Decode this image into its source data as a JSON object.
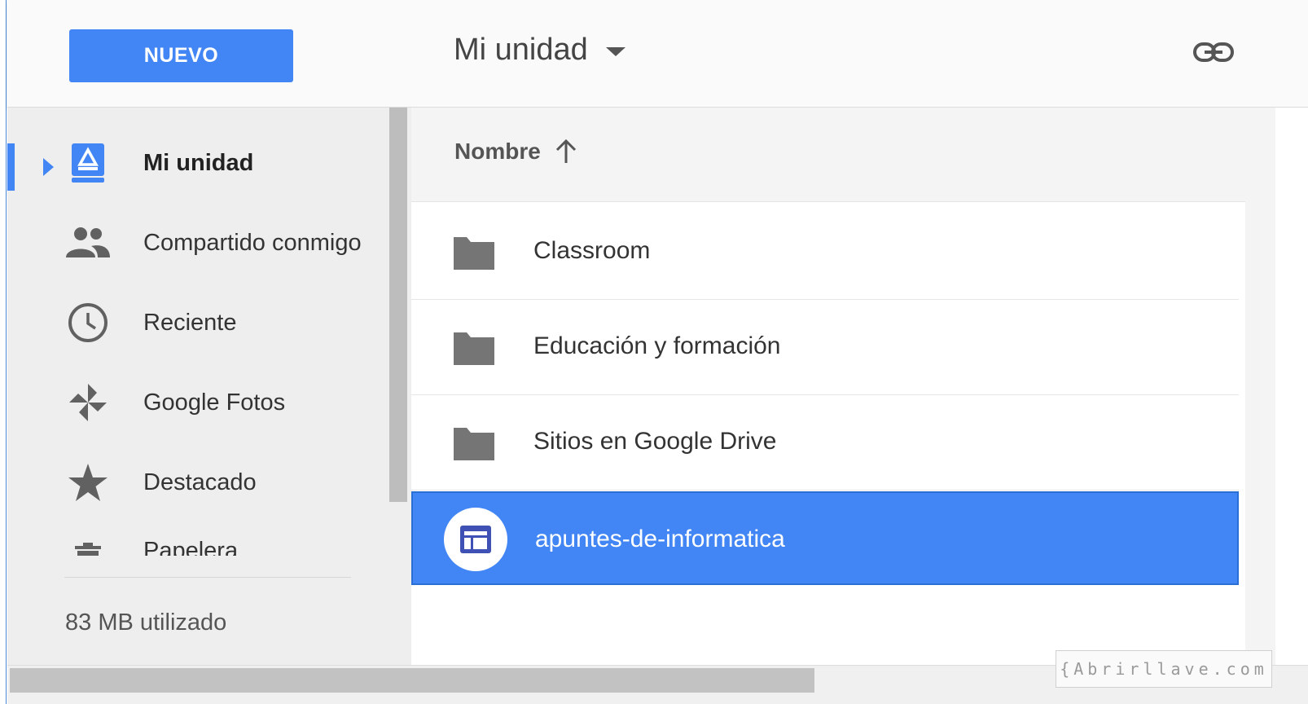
{
  "toolbar": {
    "new_label": "NUEVO",
    "location_title": "Mi unidad",
    "link_icon": "link-icon"
  },
  "sidebar": {
    "items": [
      {
        "label": "Mi unidad",
        "icon": "drive-icon",
        "active": true
      },
      {
        "label": "Compartido conmigo",
        "icon": "people-icon"
      },
      {
        "label": "Reciente",
        "icon": "clock-icon"
      },
      {
        "label": "Google Fotos",
        "icon": "photos-pinwheel-icon"
      },
      {
        "label": "Destacado",
        "icon": "star-icon"
      },
      {
        "label": "Papelera",
        "icon": "trash-icon"
      }
    ],
    "storage": "83 MB utilizado"
  },
  "file_list": {
    "header": "Nombre",
    "sort": "ascending",
    "items": [
      {
        "name": "Classroom",
        "type": "folder"
      },
      {
        "name": "Educación y formación",
        "type": "folder"
      },
      {
        "name": "Sitios en Google Drive",
        "type": "folder"
      },
      {
        "name": "apuntes-de-informatica",
        "type": "site",
        "selected": true
      }
    ]
  },
  "watermark": "{Abrirllave.com",
  "colors": {
    "accent": "#4285f4",
    "sidebar_bg": "#eeeeee",
    "folder_icon": "#757575"
  }
}
